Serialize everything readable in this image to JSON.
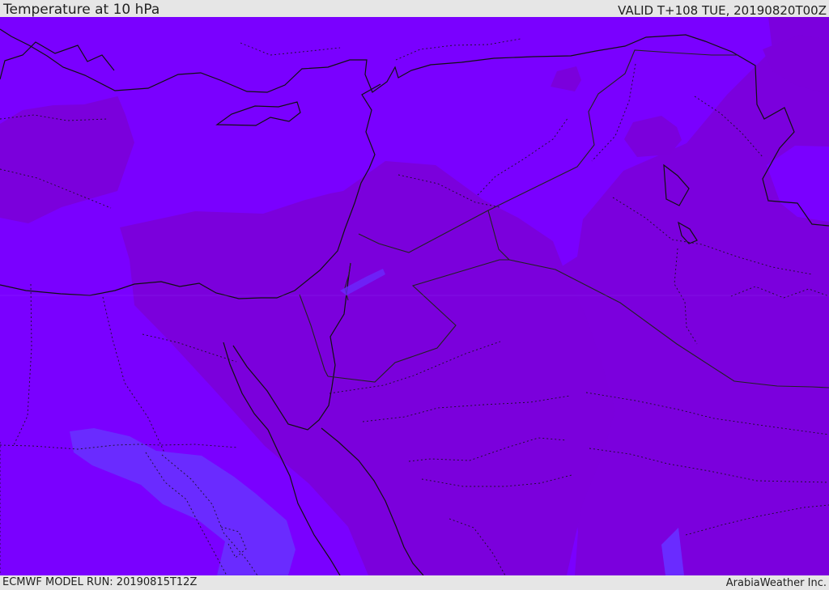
{
  "header": {
    "title": "Temperature at 10 hPa",
    "valid": "VALID T+108 TUE, 20190820T00Z"
  },
  "footer": {
    "model_run": "ECMWF MODEL RUN: 20190815T12Z",
    "credit": "ArabiaWeather Inc."
  },
  "map": {
    "colors": {
      "warmer_field": "#7a00ff",
      "dark_field": "#7b00dc",
      "cooler_field": "#6a2bff",
      "coastline": "#111111",
      "border": "#222222"
    }
  }
}
